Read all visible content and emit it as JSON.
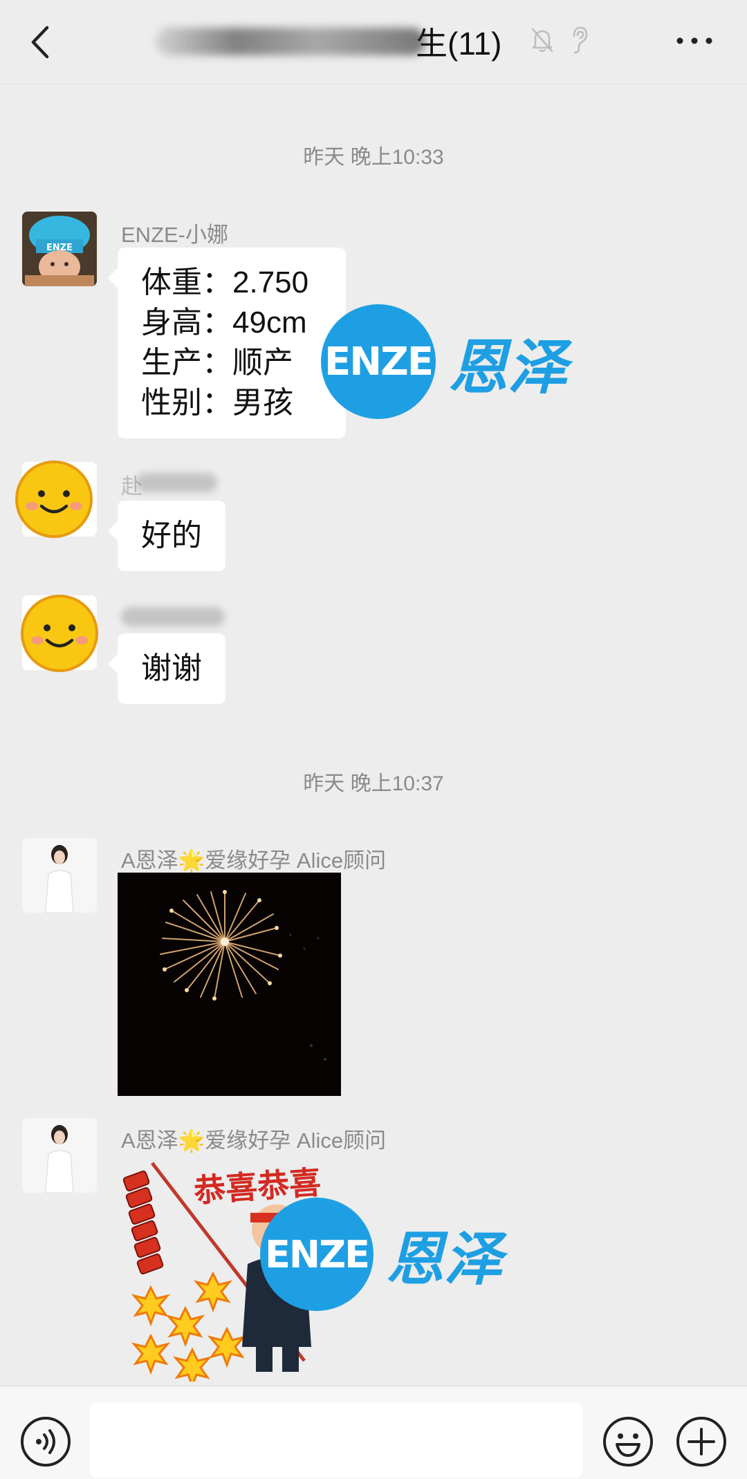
{
  "header": {
    "title_visible": "生(11)",
    "back_icon": "back-chevron-icon",
    "mute_icon": "mute-bell-icon",
    "ear_icon": "earpiece-icon",
    "more_icon": "more-dots-icon"
  },
  "timestamps": [
    "昨天 晚上10:33",
    "昨天 晚上10:37"
  ],
  "messages": [
    {
      "sender": "ENZE-小娜",
      "lines": [
        "体重：2.750",
        "身高：49cm",
        "生产：顺产",
        "性别：男孩"
      ]
    },
    {
      "sender_visible": "赴",
      "text": "好的"
    },
    {
      "text": "谢谢"
    },
    {
      "sender": "A恩泽🌟爱缘好孕 Alice顾问",
      "image": "fireworks-photo"
    },
    {
      "sender": "A恩泽🌟爱缘好孕 Alice顾问",
      "sticker_title": "恭喜恭喜",
      "image": "firecracker-sticker"
    }
  ],
  "watermark": {
    "logo": "ENZE",
    "text": "恩泽"
  },
  "avatar_badge": "ENZE",
  "colors": {
    "brand": "#1f9fe3",
    "background": "#ededed",
    "bubble": "#ffffff",
    "sticker_red": "#d32a22"
  },
  "input_bar": {
    "voice_icon": "voice-icon",
    "emoji_icon": "emoji-icon",
    "plus_icon": "plus-icon"
  }
}
